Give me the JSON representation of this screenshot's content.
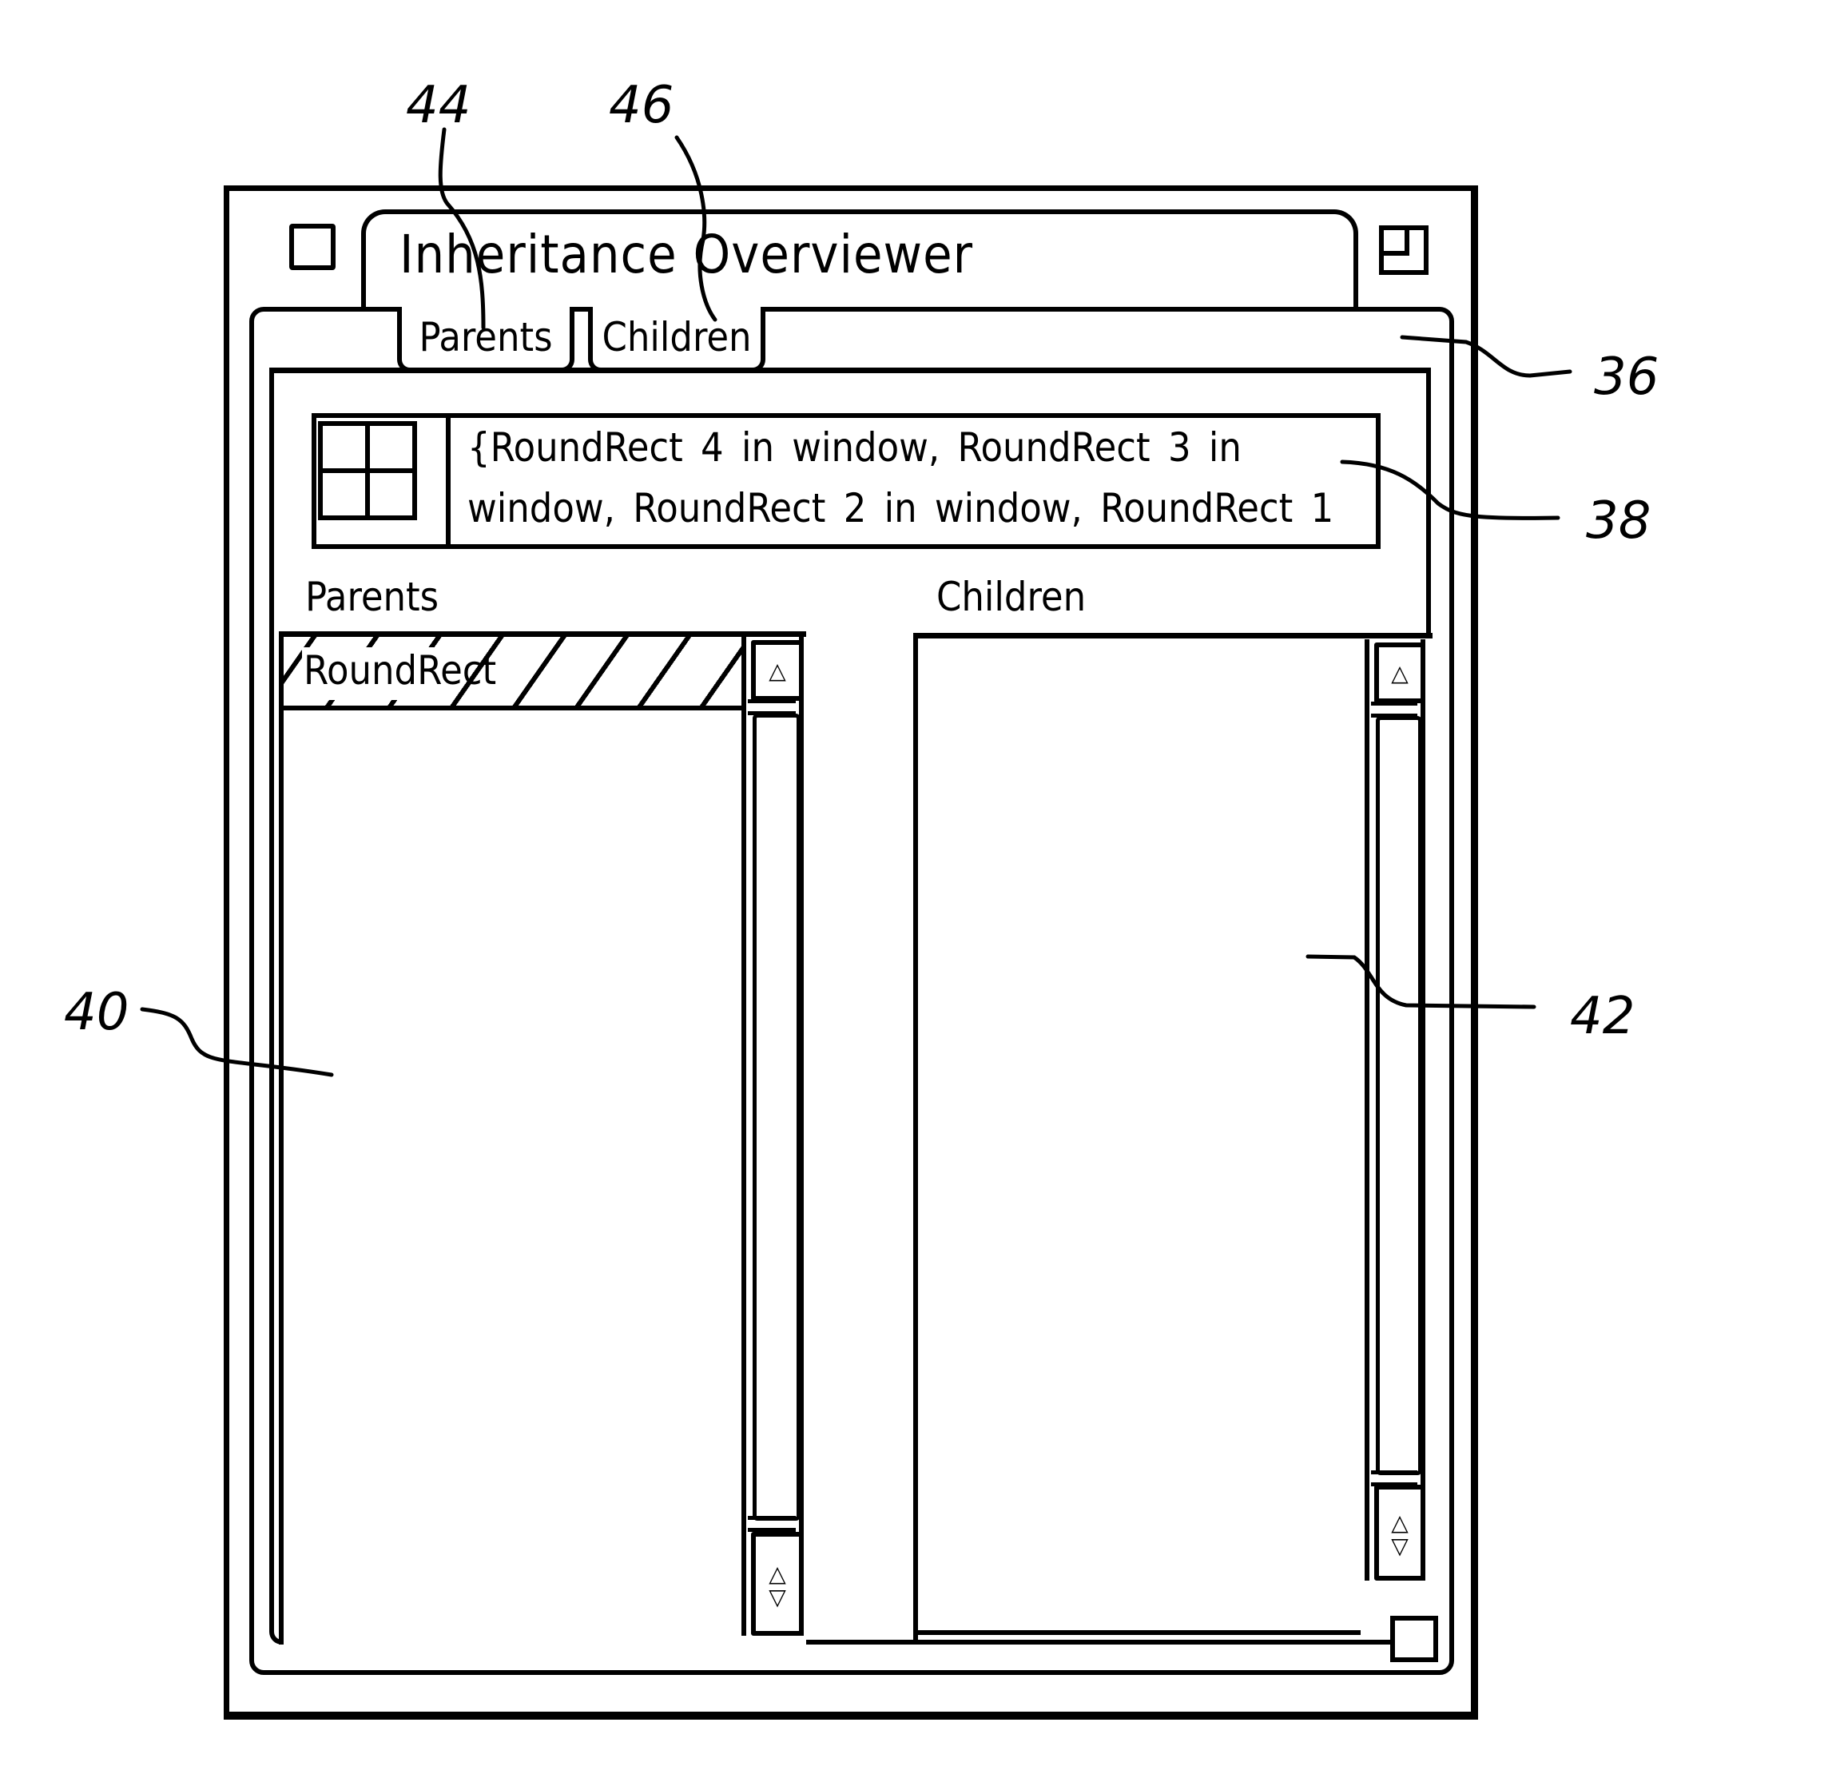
{
  "window": {
    "title": "Inheritance Overviewer",
    "close_box_icon": "close-box-icon",
    "zoom_box_icon": "zoom-box-icon",
    "grow_box_icon": "grow-box-icon"
  },
  "tabs": [
    {
      "label": "Parents",
      "name": "tab-parents"
    },
    {
      "label": "Children",
      "name": "tab-children"
    }
  ],
  "summary": {
    "icon": "grid-icon",
    "line1": "{RoundRect 4 in window, RoundRect 3 in",
    "line2": "window, RoundRect 2 in window, RoundRect 1"
  },
  "parents_list": {
    "label": "Parents",
    "items": [
      {
        "label": "RoundRect",
        "selected": true
      }
    ],
    "scroll_up_icon": "△",
    "scroll_updown_icon": "△▽"
  },
  "children_list": {
    "label": "Children",
    "items": [],
    "scroll_up_icon": "△",
    "scroll_updown_icon": "△▽"
  },
  "reference_numerals": {
    "window": "36",
    "summary_field": "38",
    "parents_pane": "40",
    "children_pane": "42",
    "parents_tab": "44",
    "children_tab": "46"
  }
}
